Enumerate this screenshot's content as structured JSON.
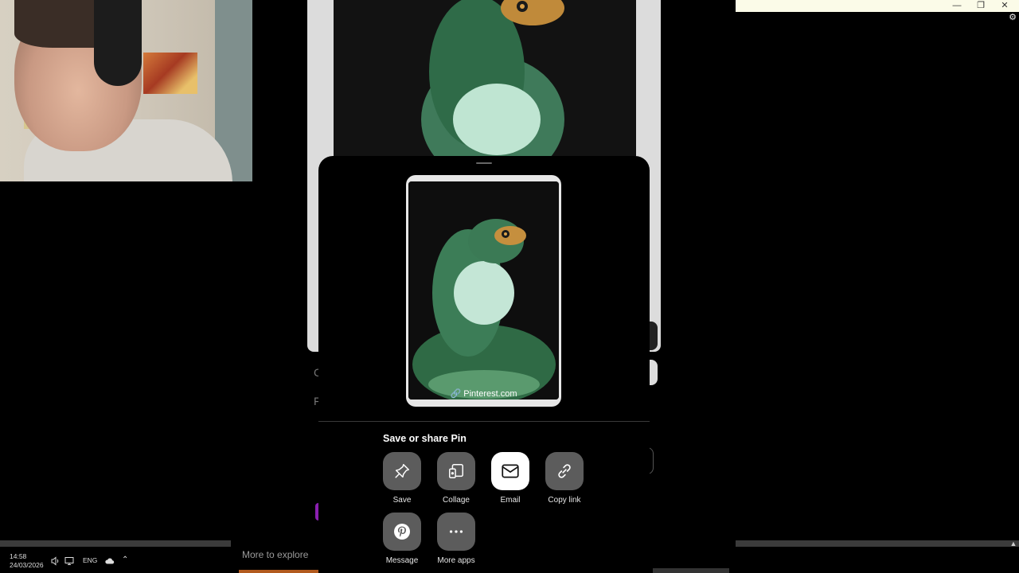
{
  "window": {
    "minimize_glyph": "—",
    "restore_glyph": "❐",
    "close_glyph": "✕",
    "settings_icon": "gear-icon"
  },
  "background_page": {
    "ghost_letter_1": "C",
    "ghost_letter_2": "F"
  },
  "share_sheet": {
    "preview_source": "Pinterest.com",
    "title": "Save or share Pin",
    "actions": [
      {
        "label": "Save",
        "icon": "pin-icon"
      },
      {
        "label": "Collage",
        "icon": "collage-icon"
      },
      {
        "label": "Email",
        "icon": "mail-icon"
      },
      {
        "label": "Copy link",
        "icon": "link-icon"
      },
      {
        "label": "Message",
        "icon": "pinterest-logo-icon"
      },
      {
        "label": "More apps",
        "icon": "more-dots-icon"
      }
    ]
  },
  "feed": {
    "more_to_explore": "More to explore"
  },
  "taskbar": {
    "time": "14:58",
    "date": "24/03/2026",
    "language": "ENG",
    "tray_icons": [
      "speaker-icon",
      "network-icon",
      "cloud-icon",
      "chevron-up-icon"
    ]
  }
}
